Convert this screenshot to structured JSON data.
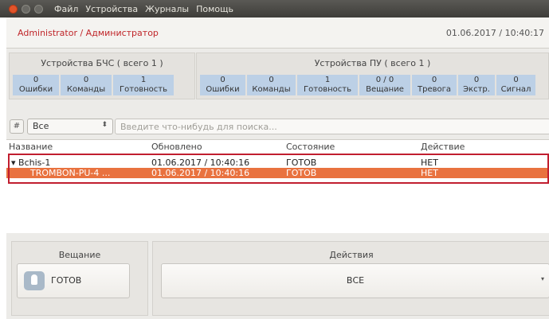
{
  "menubar": {
    "items": [
      "Файл",
      "Устройства",
      "Журналы",
      "Помощь"
    ]
  },
  "header": {
    "user": "Administrator / Администратор",
    "datetime": "01.06.2017 / 10:40:17"
  },
  "bchs_panel": {
    "title": "Устройства БЧС ( всего 1 )",
    "stats": [
      {
        "value": "0",
        "label": "Ошибки"
      },
      {
        "value": "0",
        "label": "Команды"
      },
      {
        "value": "1",
        "label": "Готовность"
      }
    ]
  },
  "pu_panel": {
    "title": "Устройства ПУ ( всего 1 )",
    "stats": [
      {
        "value": "0",
        "label": "Ошибки"
      },
      {
        "value": "0",
        "label": "Команды"
      },
      {
        "value": "1",
        "label": "Готовность"
      },
      {
        "value": "0 / 0",
        "label": "Вещание"
      },
      {
        "value": "0",
        "label": "Тревога"
      },
      {
        "value": "0",
        "label": "Экстр."
      },
      {
        "value": "0",
        "label": "Сигнал"
      }
    ]
  },
  "filter": {
    "icon_text": "#",
    "selected": "Все",
    "search_placeholder": "Введите что-нибудь для поиска..."
  },
  "table": {
    "columns": [
      "Название",
      "Обновлено",
      "Состояние",
      "Действие"
    ],
    "rows": [
      {
        "name": "▾ Bchis-1",
        "updated": "01.06.2017 / 10:40:16",
        "state": "ГОТОВ",
        "action": "НЕТ"
      },
      {
        "name": "TROMBON-PU-4 ...",
        "updated": "01.06.2017 / 10:40:16",
        "state": "ГОТОВ",
        "action": "НЕТ"
      }
    ]
  },
  "broadcast": {
    "title": "Вещание",
    "button": "ГОТОВ"
  },
  "actions": {
    "title": "Действия",
    "select": "ВСЕ",
    "dropdown_arrow": "▾"
  },
  "colors": {
    "accent_red": "#c0262a",
    "selection": "#e9723f",
    "stat_bg": "#bcd0e6"
  }
}
